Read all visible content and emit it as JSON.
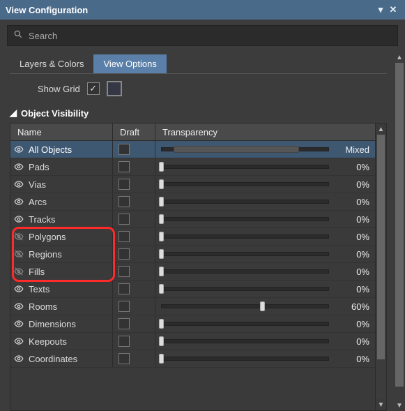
{
  "title": "View Configuration",
  "search": {
    "placeholder": "Search"
  },
  "tabs": [
    {
      "label": "Layers & Colors",
      "active": false
    },
    {
      "label": "View Options",
      "active": true
    }
  ],
  "show_grid": {
    "label": "Show Grid",
    "checked": true
  },
  "section": {
    "title": "Object Visibility"
  },
  "columns": {
    "name": "Name",
    "draft": "Draft",
    "transparency": "Transparency"
  },
  "rows": [
    {
      "name": "All Objects",
      "visible": true,
      "selected": true,
      "transparency_label": "Mixed",
      "slider_percent": 50,
      "slider_big": true
    },
    {
      "name": "Pads",
      "visible": true,
      "transparency_label": "0%",
      "slider_percent": 0
    },
    {
      "name": "Vias",
      "visible": true,
      "transparency_label": "0%",
      "slider_percent": 0
    },
    {
      "name": "Arcs",
      "visible": true,
      "transparency_label": "0%",
      "slider_percent": 0
    },
    {
      "name": "Tracks",
      "visible": true,
      "transparency_label": "0%",
      "slider_percent": 0
    },
    {
      "name": "Polygons",
      "visible": false,
      "transparency_label": "0%",
      "slider_percent": 0,
      "highlight": true
    },
    {
      "name": "Regions",
      "visible": false,
      "transparency_label": "0%",
      "slider_percent": 0,
      "highlight": true
    },
    {
      "name": "Fills",
      "visible": false,
      "transparency_label": "0%",
      "slider_percent": 0,
      "highlight": true
    },
    {
      "name": "Texts",
      "visible": true,
      "transparency_label": "0%",
      "slider_percent": 0
    },
    {
      "name": "Rooms",
      "visible": true,
      "transparency_label": "60%",
      "slider_percent": 60
    },
    {
      "name": "Dimensions",
      "visible": true,
      "transparency_label": "0%",
      "slider_percent": 0
    },
    {
      "name": "Keepouts",
      "visible": true,
      "transparency_label": "0%",
      "slider_percent": 0
    },
    {
      "name": "Coordinates",
      "visible": true,
      "transparency_label": "0%",
      "slider_percent": 0
    }
  ]
}
